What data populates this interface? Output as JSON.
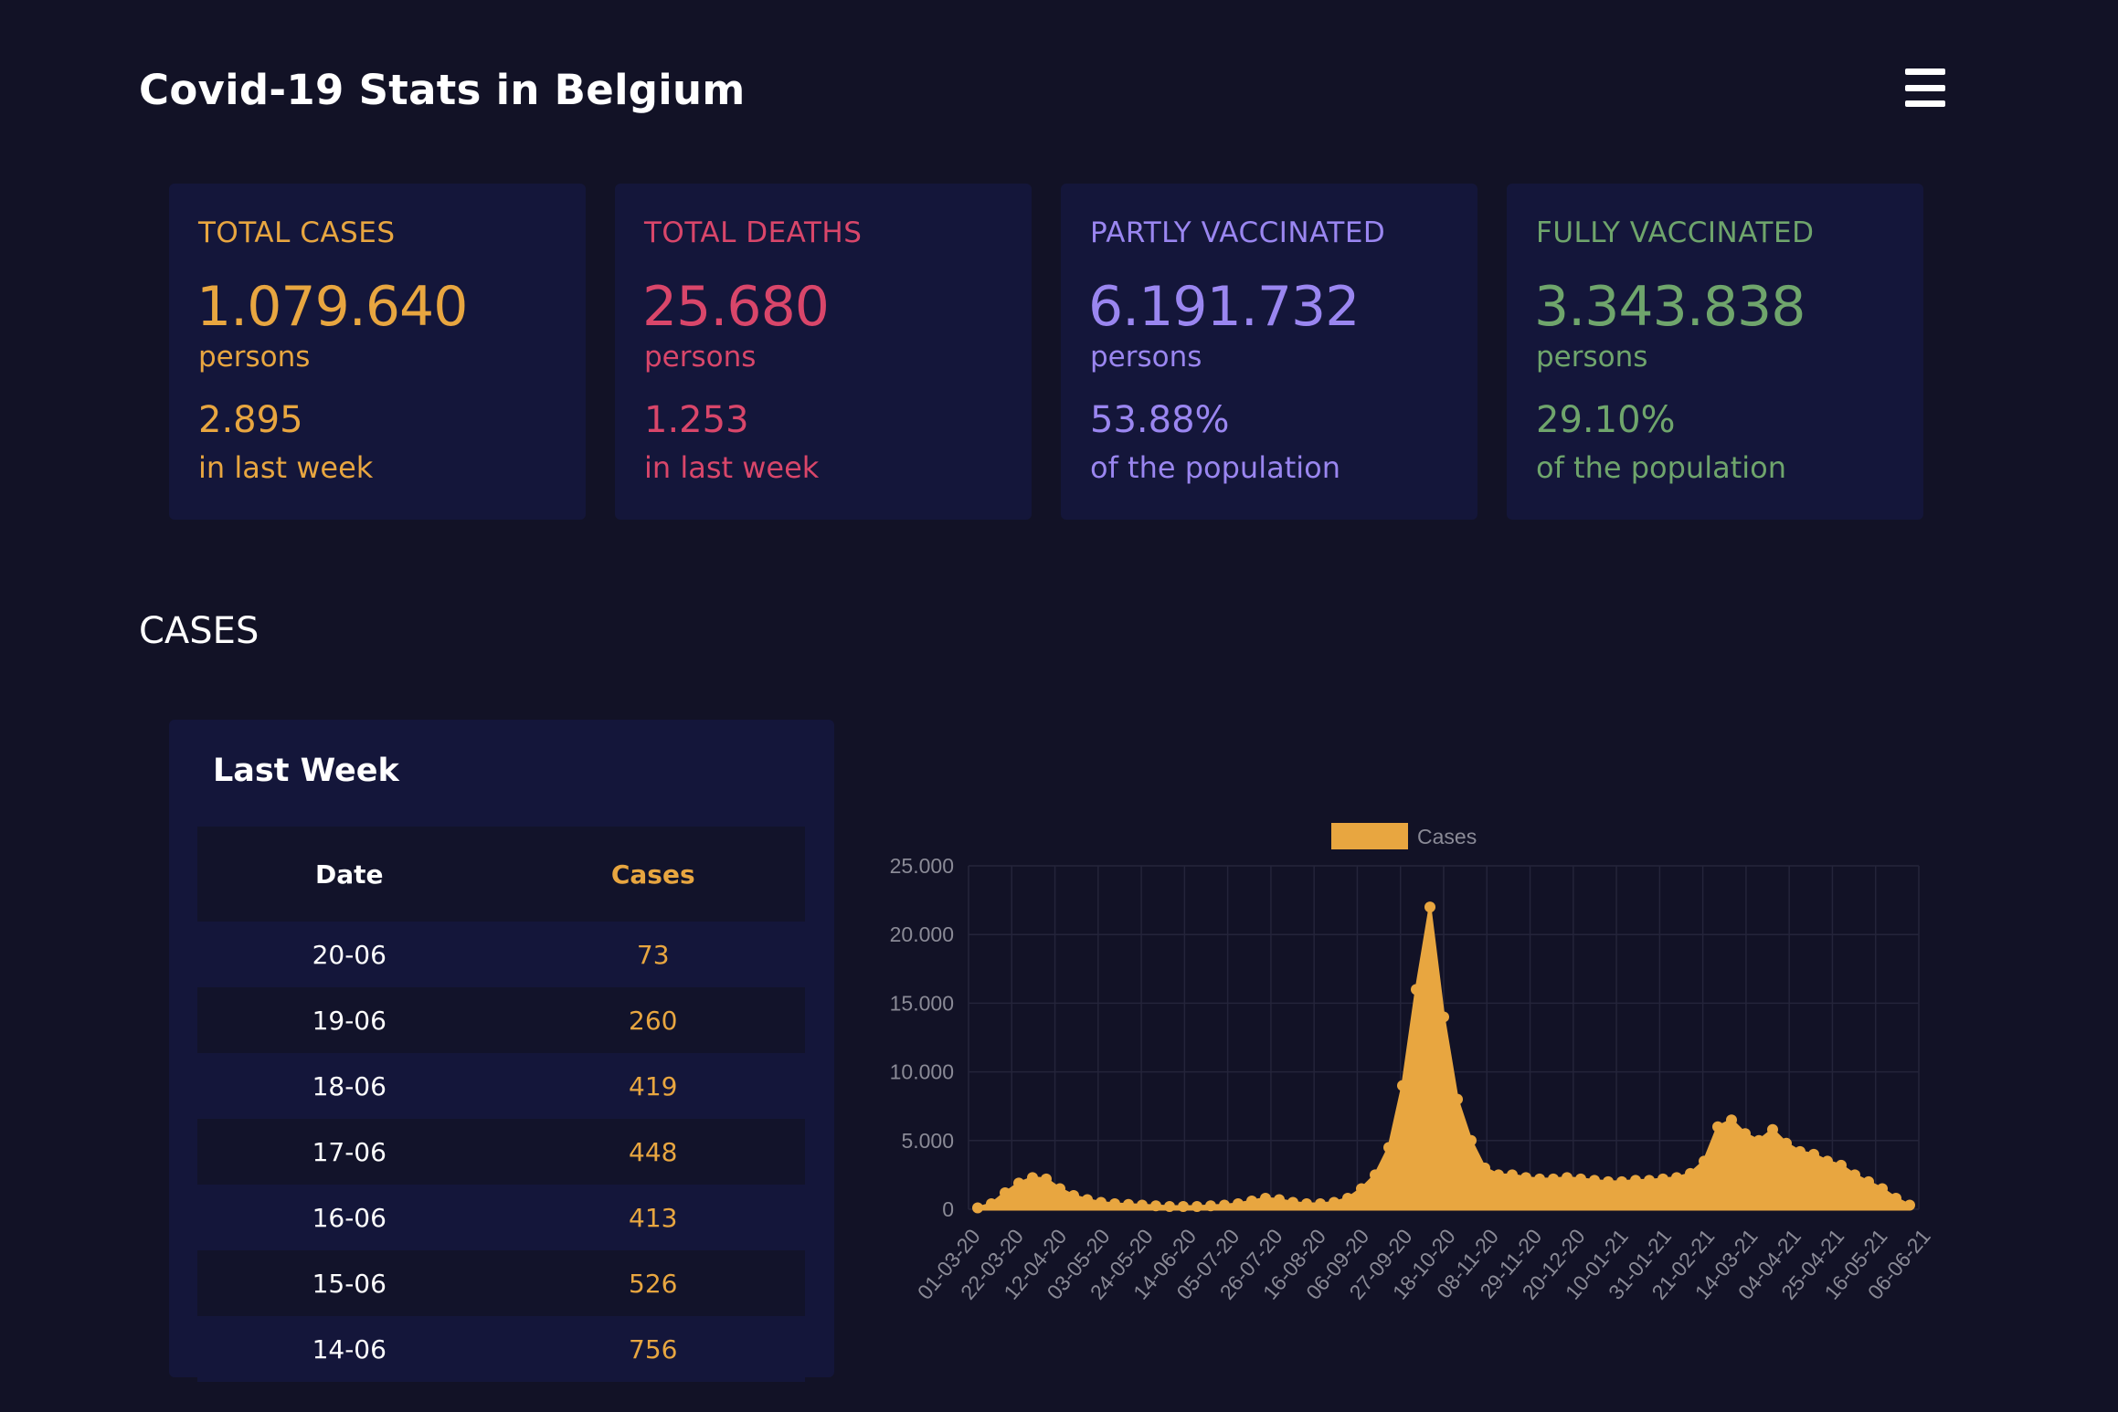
{
  "header": {
    "title": "Covid-19 Stats in Belgium",
    "menu_icon": "hamburger-menu-icon"
  },
  "colors": {
    "background": "#121226",
    "card": "#14163a",
    "cases": "#e8a640",
    "deaths": "#d9466a",
    "partly": "#9a86f0",
    "fully": "#6fa56c"
  },
  "stats": [
    {
      "label": "TOTAL CASES",
      "value": "1.079.640",
      "unit": "persons",
      "sub_value": "2.895",
      "sub_label": "in last week",
      "color": "#e8a640"
    },
    {
      "label": "TOTAL DEATHS",
      "value": "25.680",
      "unit": "persons",
      "sub_value": "1.253",
      "sub_label": "in last week",
      "color": "#d9466a"
    },
    {
      "label": "PARTLY VACCINATED",
      "value": "6.191.732",
      "unit": "persons",
      "sub_value": "53.88%",
      "sub_label": "of the population",
      "color": "#9a86f0"
    },
    {
      "label": "FULLY VACCINATED",
      "value": "3.343.838",
      "unit": "persons",
      "sub_value": "29.10%",
      "sub_label": "of the population",
      "color": "#6fa56c"
    }
  ],
  "cases_section": {
    "title": "CASES",
    "table_title": "Last Week",
    "columns": [
      "Date",
      "Cases"
    ],
    "rows": [
      [
        "20-06",
        "73"
      ],
      [
        "19-06",
        "260"
      ],
      [
        "18-06",
        "419"
      ],
      [
        "17-06",
        "448"
      ],
      [
        "16-06",
        "413"
      ],
      [
        "15-06",
        "526"
      ],
      [
        "14-06",
        "756"
      ]
    ]
  },
  "chart_data": {
    "type": "area",
    "legend": [
      "Cases"
    ],
    "legend_position": "top",
    "color": "#e8a640",
    "grid": true,
    "ylim": [
      0,
      25000
    ],
    "y_ticks": [
      "0",
      "5.000",
      "10.000",
      "15.000",
      "20.000",
      "25.000"
    ],
    "x_ticks": [
      "01-03-20",
      "22-03-20",
      "12-04-20",
      "03-05-20",
      "24-05-20",
      "14-06-20",
      "05-07-20",
      "26-07-20",
      "16-08-20",
      "06-09-20",
      "27-09-20",
      "18-10-20",
      "08-11-20",
      "29-11-20",
      "20-12-20",
      "10-01-21",
      "31-01-21",
      "21-02-21",
      "14-03-21",
      "04-04-21",
      "25-04-21",
      "16-05-21",
      "06-06-21"
    ],
    "series": [
      {
        "name": "Cases",
        "x": [
          "01-03-20",
          "08-03-20",
          "15-03-20",
          "22-03-20",
          "29-03-20",
          "05-04-20",
          "12-04-20",
          "19-04-20",
          "26-04-20",
          "03-05-20",
          "10-05-20",
          "17-05-20",
          "24-05-20",
          "31-05-20",
          "07-06-20",
          "14-06-20",
          "21-06-20",
          "28-06-20",
          "05-07-20",
          "12-07-20",
          "19-07-20",
          "26-07-20",
          "02-08-20",
          "09-08-20",
          "16-08-20",
          "23-08-20",
          "30-08-20",
          "06-09-20",
          "13-09-20",
          "20-09-20",
          "27-09-20",
          "04-10-20",
          "11-10-20",
          "18-10-20",
          "25-10-20",
          "01-11-20",
          "08-11-20",
          "15-11-20",
          "22-11-20",
          "29-11-20",
          "06-12-20",
          "13-12-20",
          "20-12-20",
          "27-12-20",
          "03-01-21",
          "10-01-21",
          "17-01-21",
          "24-01-21",
          "31-01-21",
          "07-02-21",
          "14-02-21",
          "21-02-21",
          "28-02-21",
          "07-03-21",
          "14-03-21",
          "21-03-21",
          "28-03-21",
          "04-04-21",
          "11-04-21",
          "18-04-21",
          "25-04-21",
          "02-05-21",
          "09-05-21",
          "16-05-21",
          "23-05-21",
          "30-05-21",
          "06-06-21",
          "13-06-21",
          "20-06-21"
        ],
        "values": [
          100,
          400,
          1200,
          1900,
          2300,
          2200,
          1500,
          1000,
          700,
          500,
          400,
          350,
          300,
          250,
          200,
          200,
          200,
          250,
          300,
          400,
          600,
          800,
          700,
          500,
          400,
          400,
          500,
          800,
          1500,
          2500,
          4500,
          9000,
          16000,
          22000,
          14000,
          8000,
          5000,
          3000,
          2500,
          2500,
          2300,
          2200,
          2200,
          2300,
          2200,
          2100,
          2000,
          2000,
          2100,
          2100,
          2200,
          2300,
          2600,
          3500,
          6000,
          6500,
          5500,
          5000,
          5800,
          4800,
          4200,
          4000,
          3500,
          3200,
          2500,
          2000,
          1500,
          800,
          300
        ]
      }
    ]
  }
}
